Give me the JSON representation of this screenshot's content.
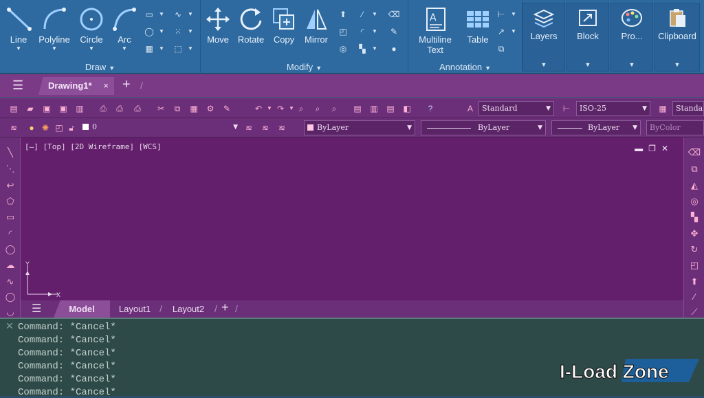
{
  "ribbon": {
    "draw": {
      "title": "Draw",
      "tools": [
        {
          "label": "Line",
          "icon": "line-icon"
        },
        {
          "label": "Polyline",
          "icon": "polyline-icon"
        },
        {
          "label": "Circle",
          "icon": "circle-icon"
        },
        {
          "label": "Arc",
          "icon": "arc-icon"
        }
      ]
    },
    "modify": {
      "title": "Modify",
      "tools": [
        {
          "label": "Move",
          "icon": "move-icon"
        },
        {
          "label": "Rotate",
          "icon": "rotate-icon"
        },
        {
          "label": "Copy",
          "icon": "copy-icon"
        },
        {
          "label": "Mirror",
          "icon": "mirror-icon"
        }
      ]
    },
    "annotation": {
      "title": "Annotation",
      "tools": [
        {
          "label": "Multiline",
          "sublabel": "Text",
          "icon": "multiline-text-icon"
        },
        {
          "label": "Table",
          "icon": "table-icon"
        }
      ]
    },
    "panels": [
      {
        "label": "Layers",
        "icon": "layers-icon"
      },
      {
        "label": "Block",
        "icon": "block-icon"
      },
      {
        "label": "Pro...",
        "icon": "properties-icon"
      },
      {
        "label": "Clipboard",
        "icon": "clipboard-icon"
      }
    ]
  },
  "tabs": {
    "document": "Drawing1*",
    "close_glyph": "×",
    "add_glyph": "+"
  },
  "toolbar": {
    "text_style": "Standard",
    "dim_style": "ISO-25",
    "table_style": "Standard",
    "layer": "0",
    "color": "ByLayer",
    "linetype": "ByLayer",
    "lineweight": "ByLayer",
    "plot_style": "ByColor"
  },
  "viewport": {
    "info": "[—] [Top] [2D Wireframe] [WCS]",
    "ucs_x": "X",
    "ucs_y": "Y"
  },
  "layouts": {
    "tabs": [
      "Model",
      "Layout1",
      "Layout2"
    ],
    "active": "Model"
  },
  "command": {
    "lines": [
      "Command: *Cancel*",
      "Command: *Cancel*",
      "Command: *Cancel*",
      "Command: *Cancel*",
      "Command: *Cancel*",
      "Command: *Cancel*"
    ]
  },
  "watermark": {
    "text": "I-Load Zone"
  },
  "colors": {
    "ribbon": "#2e6aa0",
    "tabbar": "#7a3a86",
    "canvas": "#631f6b",
    "command": "#2e4a48",
    "icon_accent": "#ffb0d6"
  }
}
